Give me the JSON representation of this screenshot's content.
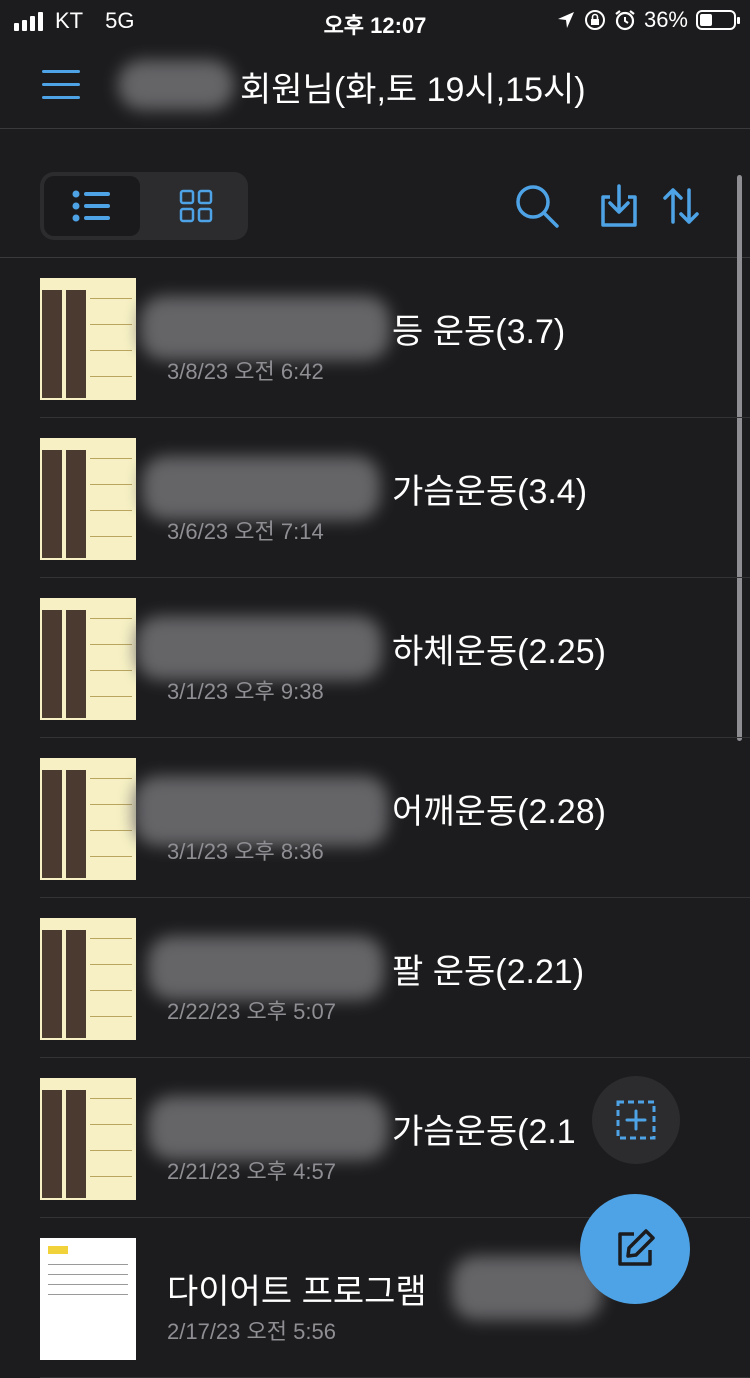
{
  "status_bar": {
    "carrier": "KT",
    "network": "5G",
    "time": "오후 12:07",
    "battery": "36%",
    "battery_level": 0.36
  },
  "header": {
    "title": "회원님(화,토 19시,15시)",
    "menu_icon": "hamburger-menu-icon"
  },
  "toolbar": {
    "view_modes": [
      "list-view-icon",
      "grid-view-icon"
    ],
    "selected_view": "list",
    "actions": [
      "search-icon",
      "download-icon",
      "sort-icon"
    ]
  },
  "files": [
    {
      "title": "등 운동(3.7)",
      "date": "3/8/23 오전 6:42"
    },
    {
      "title": "가슴운동(3.4)",
      "date": "3/6/23 오전 7:14"
    },
    {
      "title": "하체운동(2.25)",
      "date": "3/1/23 오후 9:38"
    },
    {
      "title": "어깨운동(2.28)",
      "date": "3/1/23 오후 8:36"
    },
    {
      "title": "팔 운동(2.21)",
      "date": "2/22/23 오후 5:07"
    },
    {
      "title": "가슴운동(2.1",
      "date": "2/21/23 오후 4:57"
    },
    {
      "title": "다이어트 프로그램",
      "date": "2/17/23 오전 5:56"
    }
  ],
  "colors": {
    "background": "#1c1c1e",
    "accent": "#4ea3e6",
    "secondary_text": "#8e8e93"
  }
}
